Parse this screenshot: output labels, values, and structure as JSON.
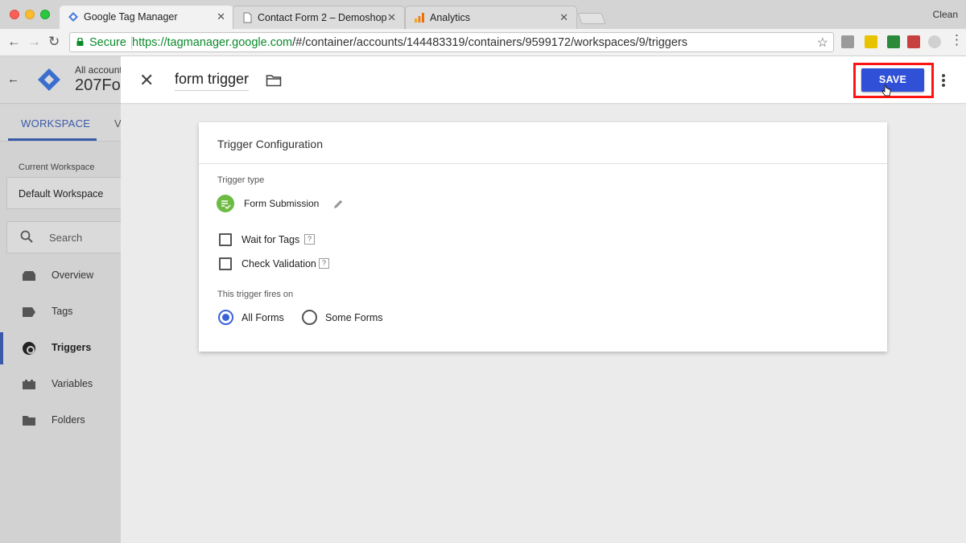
{
  "browser": {
    "tabs": [
      {
        "title": "Google Tag Manager",
        "close": "✕"
      },
      {
        "title": "Contact Form 2 – Demoshop",
        "close": "✕"
      },
      {
        "title": "Analytics",
        "close": "✕"
      }
    ],
    "profile": "Clean",
    "secure_label": "Secure",
    "url_host": "https://tagmanager.google.com",
    "url_path": "/#/container/accounts/144483319/containers/9599172/workspaces/9/triggers"
  },
  "sidebar": {
    "account_label": "All accounts",
    "container_name": "207Fo",
    "tabs": [
      "WORKSPACE",
      "V"
    ],
    "current_workspace_label": "Current Workspace",
    "current_workspace_value": "Default Workspace",
    "search_placeholder": "Search",
    "items": [
      {
        "label": "Overview",
        "icon": "overview-icon"
      },
      {
        "label": "Tags",
        "icon": "tag-icon"
      },
      {
        "label": "Triggers",
        "icon": "trigger-icon",
        "active": true
      },
      {
        "label": "Variables",
        "icon": "variables-icon"
      },
      {
        "label": "Folders",
        "icon": "folder-icon"
      }
    ]
  },
  "editor": {
    "trigger_name": "form trigger",
    "save_label": "SAVE",
    "card_title": "Trigger Configuration",
    "trigger_type_label": "Trigger type",
    "trigger_type": "Form Submission",
    "checkboxes": [
      {
        "label": "Wait for Tags",
        "checked": false,
        "help": "?"
      },
      {
        "label": "Check Validation",
        "checked": false,
        "help": "?"
      }
    ],
    "fires_on_label": "This trigger fires on",
    "fires_on_options": [
      {
        "label": "All Forms",
        "selected": true
      },
      {
        "label": "Some Forms",
        "selected": false
      }
    ]
  },
  "colors": {
    "save_button": "#3050d8",
    "highlight_outline": "#ff1414",
    "accent": "#3a5aa8",
    "form_icon": "#6dbb42"
  }
}
